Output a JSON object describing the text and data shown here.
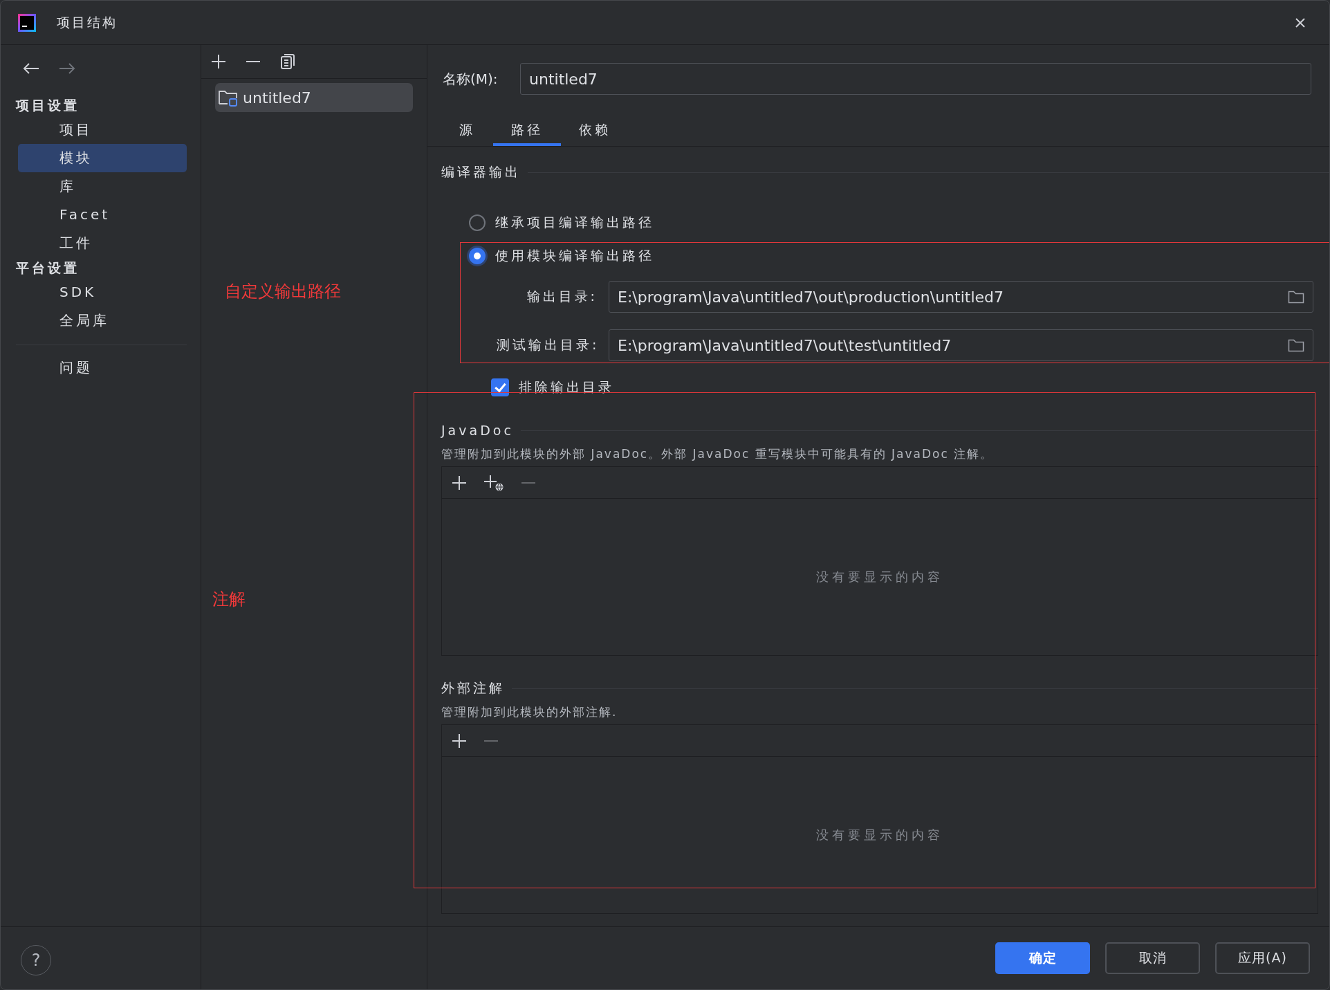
{
  "window": {
    "title": "项目结构"
  },
  "sidebar": {
    "sections": [
      {
        "heading": "项目设置",
        "items": [
          {
            "label": "项目",
            "selected": false
          },
          {
            "label": "模块",
            "selected": true
          },
          {
            "label": "库",
            "selected": false
          },
          {
            "label": "Facet",
            "selected": false
          },
          {
            "label": "工件",
            "selected": false
          }
        ]
      },
      {
        "heading": "平台设置",
        "items": [
          {
            "label": "SDK",
            "selected": false
          },
          {
            "label": "全局库",
            "selected": false
          }
        ]
      }
    ],
    "footer_items": [
      {
        "label": "问题",
        "selected": false
      }
    ]
  },
  "modules": {
    "items": [
      {
        "name": "untitled7",
        "selected": true
      }
    ]
  },
  "annotations": [
    {
      "text": "自定义输出路径"
    },
    {
      "text": "注解"
    }
  ],
  "name_field": {
    "label": "名称(M):",
    "value": "untitled7"
  },
  "tabs": [
    {
      "label": "源",
      "selected": false
    },
    {
      "label": "路径",
      "selected": true
    },
    {
      "label": "依赖",
      "selected": false
    }
  ],
  "compiler_output": {
    "title": "编译器输出",
    "options": [
      {
        "label": "继承项目编译输出路径",
        "selected": false
      },
      {
        "label": "使用模块编译输出路径",
        "selected": true
      }
    ],
    "paths": [
      {
        "label": "输出目录:",
        "value": "E:\\program\\Java\\untitled7\\out\\production\\untitled7"
      },
      {
        "label": "测试输出目录:",
        "value": "E:\\program\\Java\\untitled7\\out\\test\\untitled7"
      }
    ],
    "exclude": {
      "label": "排除输出目录",
      "checked": true
    }
  },
  "sections": [
    {
      "title": "JavaDoc",
      "description": "管理附加到此模块的外部 JavaDoc。外部 JavaDoc 重写模块中可能具有的 JavaDoc 注解。",
      "empty_text": "没有要显示的内容",
      "toolbar": [
        {
          "kind": "add",
          "disabled": false
        },
        {
          "kind": "add-url",
          "disabled": false
        },
        {
          "kind": "remove",
          "disabled": true
        }
      ]
    },
    {
      "title": "外部注解",
      "description": "管理附加到此模块的外部注解.",
      "empty_text": "没有要显示的内容",
      "toolbar": [
        {
          "kind": "add",
          "disabled": false
        },
        {
          "kind": "remove",
          "disabled": true
        }
      ]
    }
  ],
  "help": {
    "label": "?"
  },
  "buttons": [
    {
      "label": "确定",
      "kind": "primary"
    },
    {
      "label": "取消",
      "kind": "secondary"
    },
    {
      "label": "应用(A)",
      "kind": "secondary"
    }
  ]
}
